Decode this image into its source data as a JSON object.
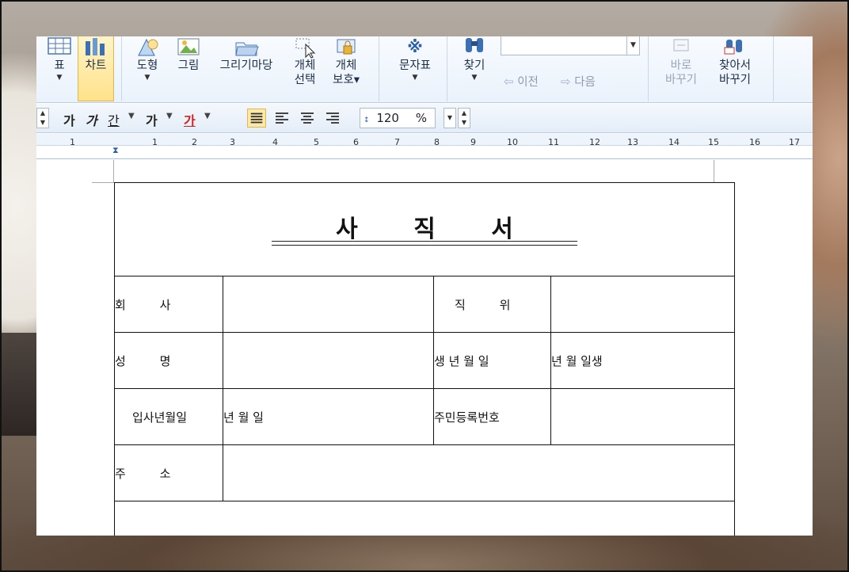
{
  "ribbon": {
    "buttons": [
      {
        "label": "표",
        "icon": "table-icon"
      },
      {
        "label": "차트",
        "icon": "chart-icon"
      },
      {
        "label": "도형",
        "icon": "shape-icon"
      },
      {
        "label": "그림",
        "icon": "picture-icon"
      },
      {
        "label": "그리기마당",
        "icon": "drawing-gallery-icon"
      },
      {
        "label_line1": "개체",
        "label_line2": "선택",
        "icon": "select-object-icon"
      },
      {
        "label_line1": "개체",
        "label_line2": "보호▾",
        "icon": "protect-object-icon"
      },
      {
        "label": "문자표",
        "icon": "symbol-icon"
      },
      {
        "label": "찾기",
        "icon": "find-icon"
      }
    ],
    "find_value": "",
    "prev_label": "이전",
    "next_label": "다음",
    "replace_label_line1": "바로",
    "replace_label_line2": "바꾸기",
    "findreplace_label_line1": "찾아서",
    "findreplace_label_line2": "바꾸기"
  },
  "format_bar": {
    "bold": "가",
    "italic": "가",
    "underline": "간",
    "strike": "가",
    "font_color": "가",
    "line_spacing_value": "120",
    "line_spacing_unit": "%"
  },
  "ruler": {
    "numbers": [
      "1",
      "1",
      "2",
      "3",
      "4",
      "5",
      "6",
      "7",
      "8",
      "9",
      "10",
      "11",
      "12",
      "13",
      "14",
      "15",
      "16",
      "17"
    ]
  },
  "document": {
    "title": "사 직 서",
    "rows": [
      {
        "label1": "회  사",
        "value1": "",
        "label2": "직  위",
        "value2": ""
      },
      {
        "label1": "성  명",
        "value1": "",
        "label2": "생 년 월 일",
        "value2": "년 월 일생"
      },
      {
        "label1": "입사년월일",
        "value1": "년  월  일",
        "label2": "주민등록번호",
        "value2": ""
      },
      {
        "label1": "주  소",
        "value1": ""
      }
    ]
  },
  "colors": {
    "ribbon_bg": "#eaf2fb",
    "active_button": "#ffe28a",
    "font_color_accent": "#d21f1f"
  }
}
